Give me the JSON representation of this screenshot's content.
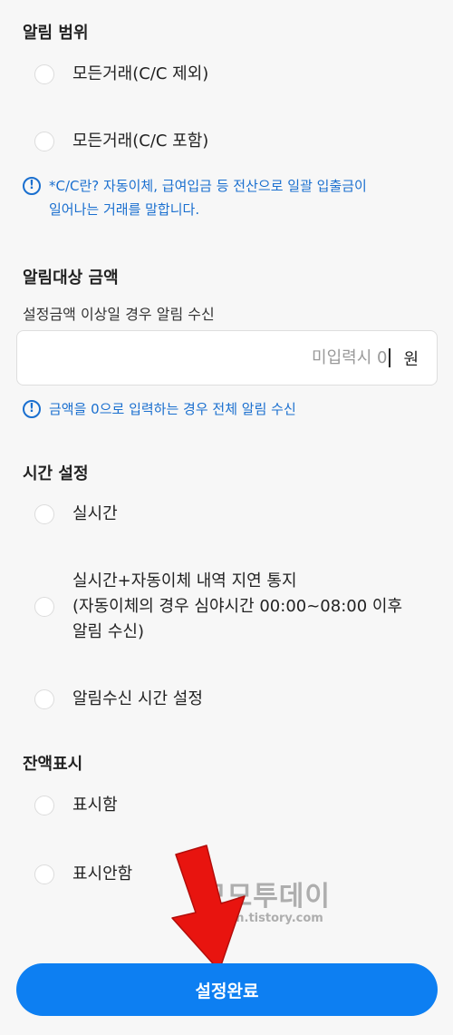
{
  "alert_scope": {
    "title": "알림 범위",
    "options": [
      {
        "label": "모든거래(C/C 제외)"
      },
      {
        "label": "모든거래(C/C 포함)"
      }
    ],
    "info_lines": [
      "*C/C란? 자동이체, 급여입금 등 전산으로 일괄 입출금이",
      "일어나는 거래를 말합니다."
    ]
  },
  "amount": {
    "title": "알림대상 금액",
    "subtitle": "설정금액 이상일 경우 알림 수신",
    "placeholder": "미입력시 0",
    "value": "",
    "unit": "원",
    "info": "금액을 0으로 입력하는 경우 전체 알림 수신"
  },
  "time": {
    "title": "시간 설정",
    "options": [
      {
        "lines": [
          "실시간"
        ]
      },
      {
        "lines": [
          "실시간+자동이체 내역 지연 통지",
          "(자동이체의 경우 심야시간 00:00~08:00 이후",
          "알림 수신)"
        ]
      },
      {
        "lines": [
          "알림수신 시간 설정"
        ]
      }
    ]
  },
  "balance": {
    "title": "잔액표시",
    "options": [
      {
        "label": "표시함"
      },
      {
        "label": "표시안함"
      }
    ]
  },
  "watermark": {
    "main": "모모투데이",
    "sub": "pjhhh.tistory.com"
  },
  "submit_label": "설정완료",
  "colors": {
    "accent": "#0d7ff2",
    "info": "#1a6fcf",
    "arrow": "#e8140f"
  }
}
